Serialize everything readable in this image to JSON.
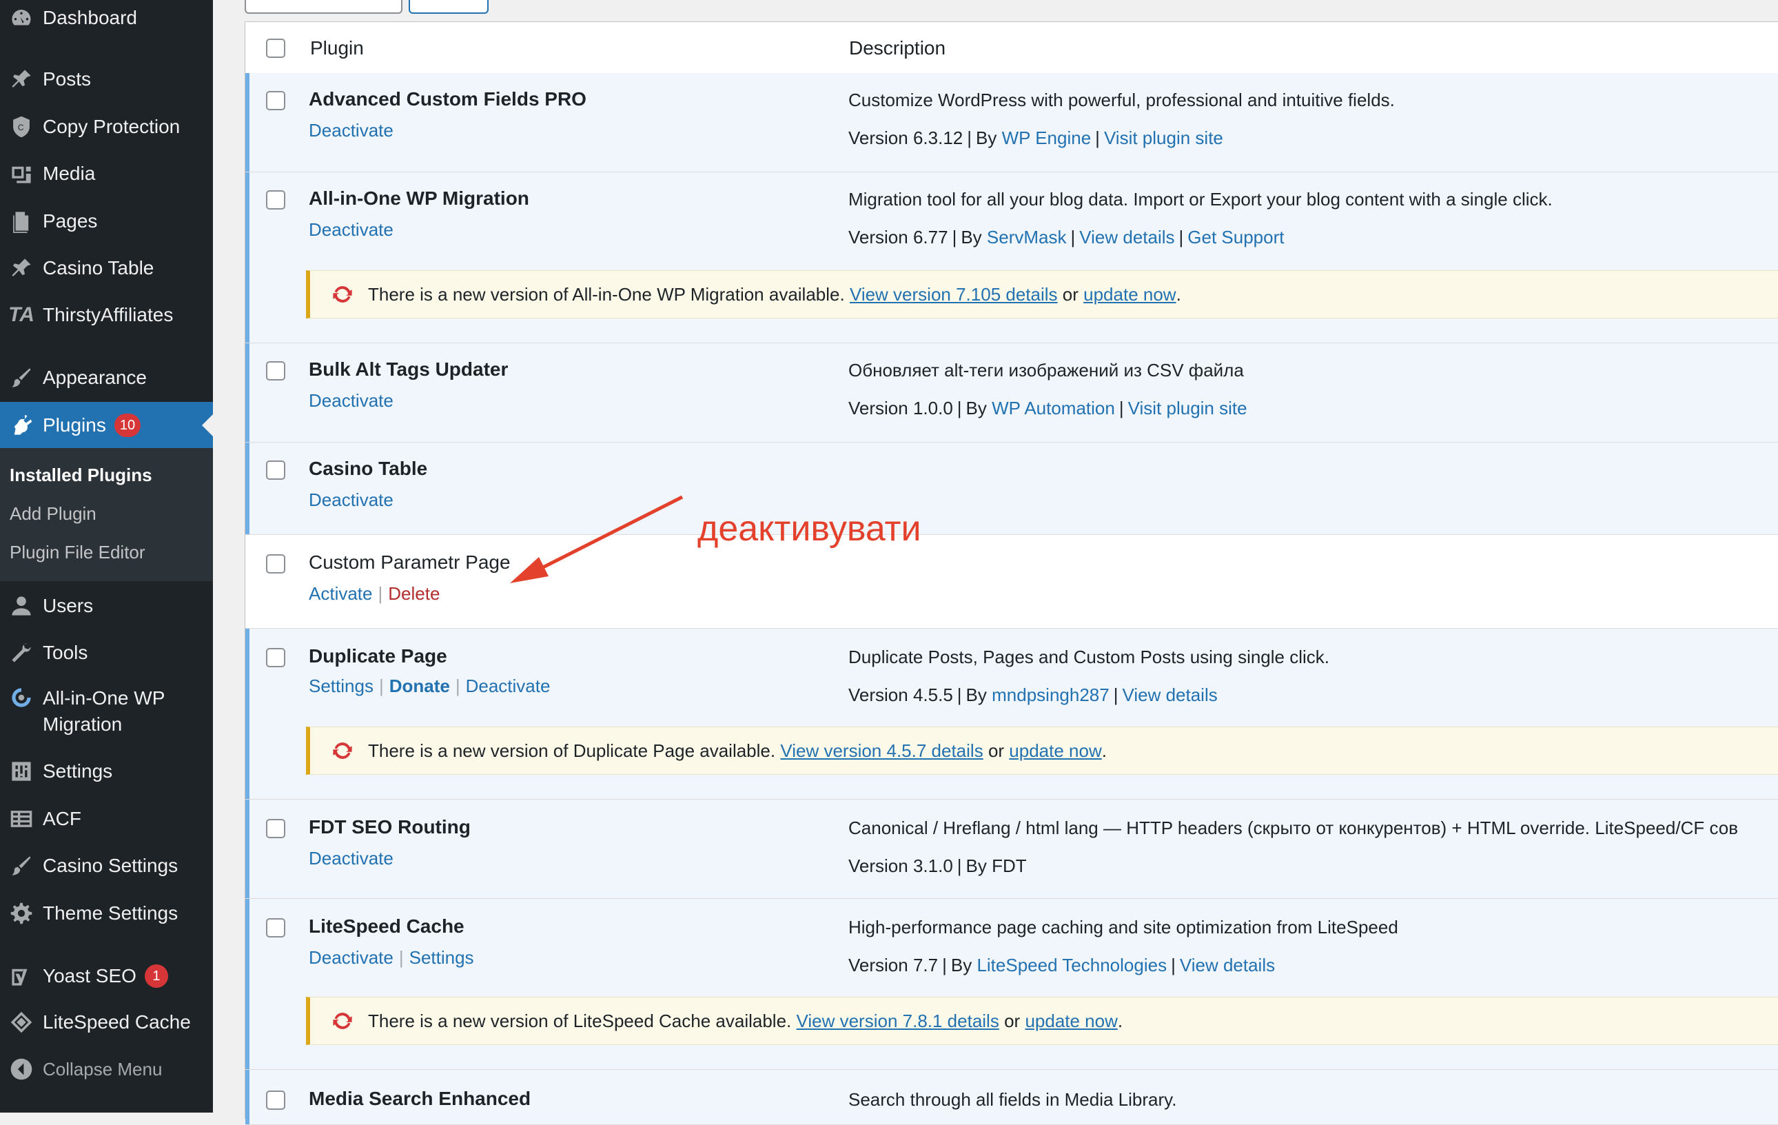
{
  "sidebar": {
    "items": [
      {
        "label": "Dashboard",
        "icon": "dashboard-icon"
      },
      {
        "label": "Posts",
        "icon": "pin-icon"
      },
      {
        "label": "Copy Protection",
        "icon": "shield-icon"
      },
      {
        "label": "Media",
        "icon": "media-icon"
      },
      {
        "label": "Pages",
        "icon": "pages-icon"
      },
      {
        "label": "Casino Table",
        "icon": "pin-icon"
      },
      {
        "label": "ThirstyAffiliates",
        "icon": "ta-logo-icon"
      },
      {
        "label": "Appearance",
        "icon": "brush-icon"
      },
      {
        "label": "Plugins",
        "icon": "plugin-icon",
        "badge": "10"
      },
      {
        "label": "Users",
        "icon": "user-icon"
      },
      {
        "label": "Tools",
        "icon": "wrench-icon"
      },
      {
        "label": "All-in-One WP Migration",
        "icon": "migration-icon"
      },
      {
        "label": "Settings",
        "icon": "settings-icon"
      },
      {
        "label": "ACF",
        "icon": "table-icon"
      },
      {
        "label": "Casino Settings",
        "icon": "brush-icon"
      },
      {
        "label": "Theme Settings",
        "icon": "gear-icon"
      },
      {
        "label": "Yoast SEO",
        "icon": "yoast-icon",
        "badge": "1"
      },
      {
        "label": "LiteSpeed Cache",
        "icon": "litespeed-icon"
      },
      {
        "label": "Collapse Menu",
        "icon": "collapse-icon"
      }
    ],
    "submenu": [
      "Installed Plugins",
      "Add Plugin",
      "Plugin File Editor"
    ]
  },
  "table": {
    "col_plugin": "Plugin",
    "col_description": "Description"
  },
  "plugins": [
    {
      "name": "Advanced Custom Fields PRO",
      "actions": [
        "Deactivate"
      ],
      "description": "Customize WordPress with powerful, professional and intuitive fields.",
      "version": "Version 6.3.12",
      "by": "By",
      "author": "WP Engine",
      "links": [
        "Visit plugin site"
      ]
    },
    {
      "name": "All-in-One WP Migration",
      "actions": [
        "Deactivate"
      ],
      "description": "Migration tool for all your blog data. Import or Export your blog content with a single click.",
      "version": "Version 6.77",
      "by": "By",
      "author": "ServMask",
      "links": [
        "View details",
        "Get Support"
      ],
      "notice": {
        "text": "There is a new version of All-in-One WP Migration available.",
        "view": "View version 7.105 details",
        "or": "or",
        "update": "update now"
      }
    },
    {
      "name": "Bulk Alt Tags Updater",
      "actions": [
        "Deactivate"
      ],
      "description": "Обновляет alt-теги изображений из CSV файла",
      "version": "Version 1.0.0",
      "by": "By",
      "author": "WP Automation",
      "links": [
        "Visit plugin site"
      ]
    },
    {
      "name": "Casino Table",
      "actions": [
        "Deactivate"
      ]
    },
    {
      "name": "Custom Parametr Page",
      "actions": [
        "Activate",
        "Delete"
      ]
    },
    {
      "name": "Duplicate Page",
      "actions": [
        "Settings",
        "Donate",
        "Deactivate"
      ],
      "description": "Duplicate Posts, Pages and Custom Posts using single click.",
      "version": "Version 4.5.5",
      "by": "By",
      "author": "mndpsingh287",
      "links": [
        "View details"
      ],
      "notice": {
        "text": "There is a new version of Duplicate Page available.",
        "view": "View version 4.5.7 details",
        "or": "or",
        "update": "update now"
      }
    },
    {
      "name": "FDT SEO Routing",
      "actions": [
        "Deactivate"
      ],
      "description": "Canonical / Hreflang / html lang — HTTP headers (скрыто от конкурентов) + HTML override. LiteSpeed/CF сов",
      "version": "Version 3.1.0",
      "by": "By FDT"
    },
    {
      "name": "LiteSpeed Cache",
      "actions": [
        "Deactivate",
        "Settings"
      ],
      "description": "High-performance page caching and site optimization from LiteSpeed",
      "version": "Version 7.7",
      "by": "By",
      "author": "LiteSpeed Technologies",
      "links": [
        "View details"
      ],
      "notice": {
        "text": "There is a new version of LiteSpeed Cache available.",
        "view": "View version 7.8.1 details",
        "or": "or",
        "update": "update now"
      }
    },
    {
      "name": "Media Search Enhanced",
      "description": "Search through all fields in Media Library."
    }
  ],
  "annotation": {
    "text": "деактивувати",
    "color": "#e3412b"
  },
  "colors": {
    "sidebar": "#1d2327",
    "accent": "#2271b1",
    "active_row": "#f0f6fc",
    "active_border": "#72aee6",
    "notice_bg": "#fcf9e8",
    "notice_border": "#dba617",
    "badge": "#d63638"
  }
}
